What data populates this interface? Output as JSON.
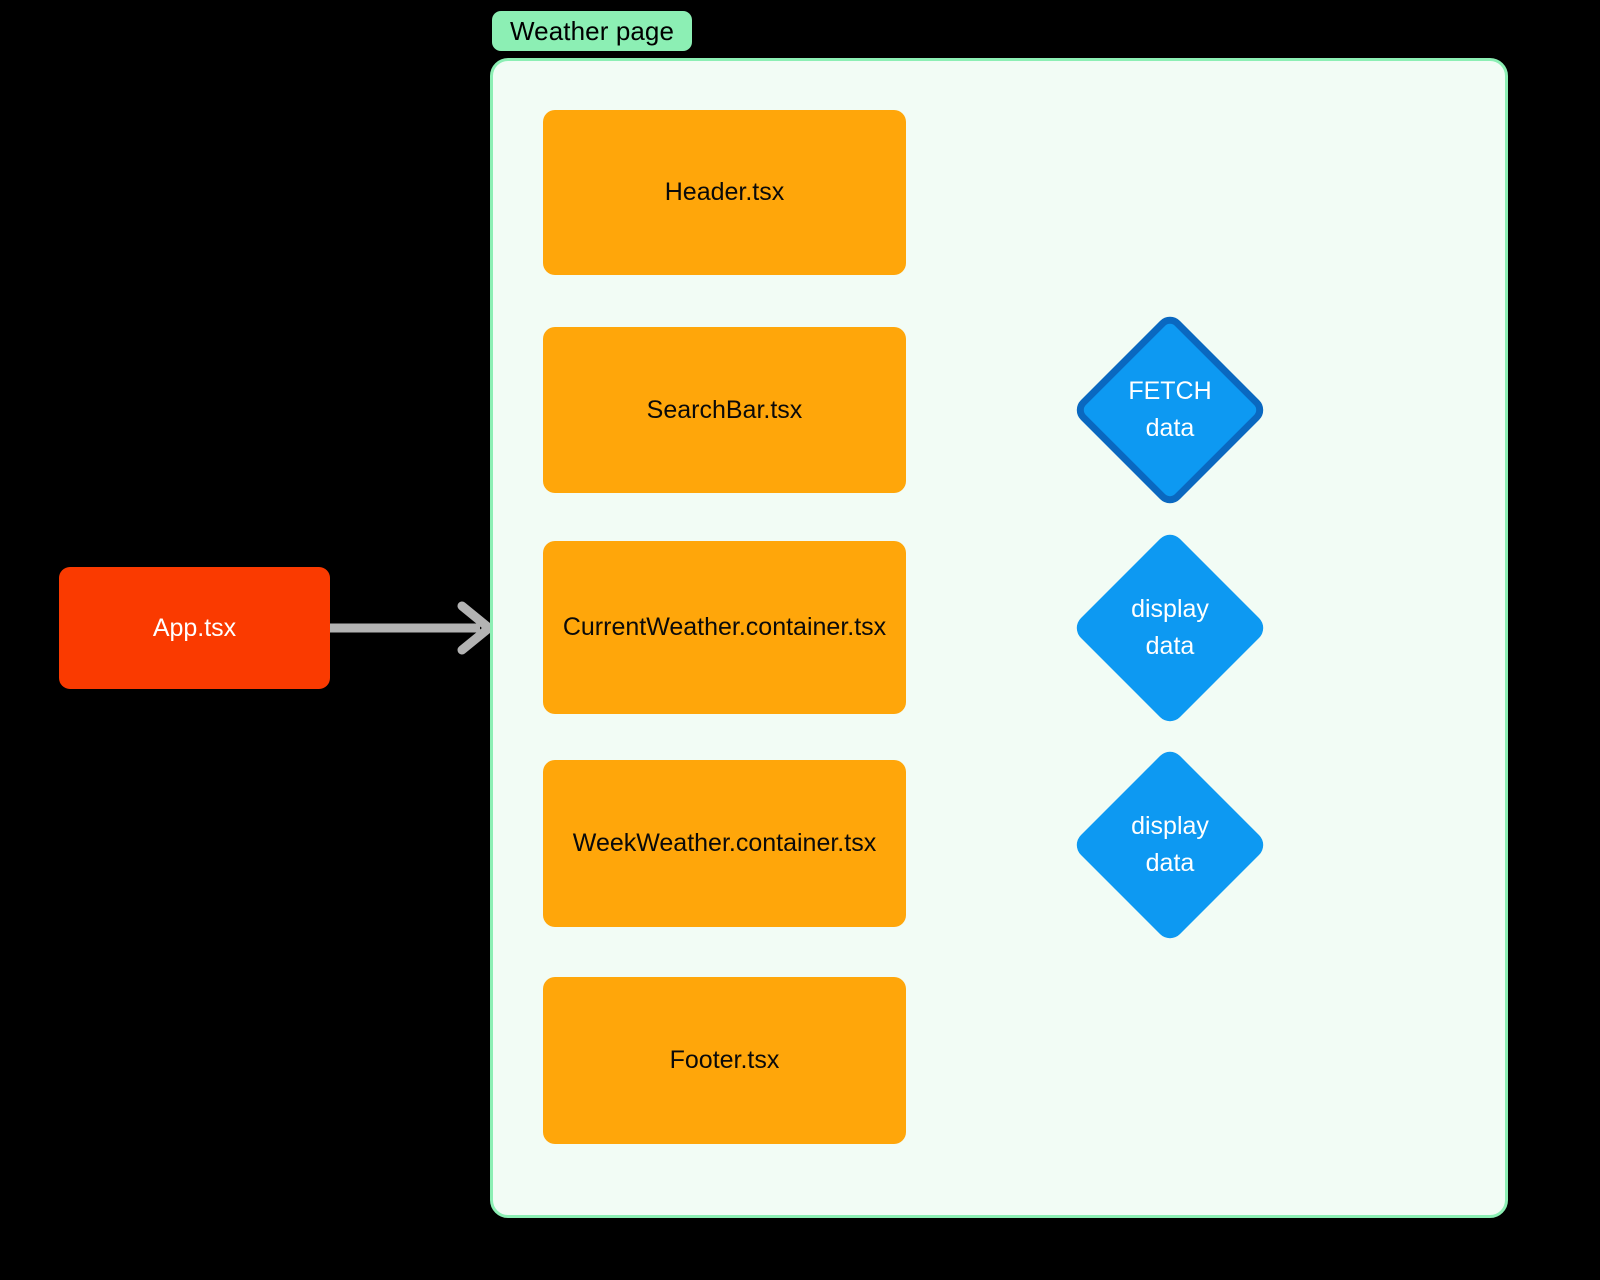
{
  "diagram": {
    "type": "flowchart",
    "background": "#000000",
    "colors": {
      "group_fill": "#f2fcf5",
      "group_border": "#8cefb4",
      "group_label_fill": "#8cefb4",
      "process_fill": "#ffa60a",
      "process_text": "#0a0a0a",
      "entry_fill": "#fa3a00",
      "entry_text": "#ffffff",
      "decision_fill": "#0d99f2",
      "decision_border": "#0a68c0",
      "decision_text": "#ffffff",
      "arrow": "#b3b3b3"
    },
    "group": {
      "label": "Weather page"
    },
    "entry_node": {
      "label": "App.tsx"
    },
    "components": [
      {
        "label": "Header.tsx"
      },
      {
        "label": "SearchBar.tsx"
      },
      {
        "label": "CurrentWeather.container.tsx"
      },
      {
        "label": "WeekWeather.container.tsx"
      },
      {
        "label": "Footer.tsx"
      }
    ],
    "decisions": [
      {
        "line1": "FETCH",
        "line2": "data"
      },
      {
        "line1": "display",
        "line2": "data"
      },
      {
        "line1": "display",
        "line2": "data"
      }
    ],
    "edges": [
      {
        "from": "App.tsx",
        "to": "Weather page"
      },
      {
        "from": "SearchBar.tsx",
        "to": "FETCH data"
      },
      {
        "from": "CurrentWeather.container.tsx",
        "to": "display data"
      },
      {
        "from": "WeekWeather.container.tsx",
        "to": "display data"
      }
    ]
  }
}
